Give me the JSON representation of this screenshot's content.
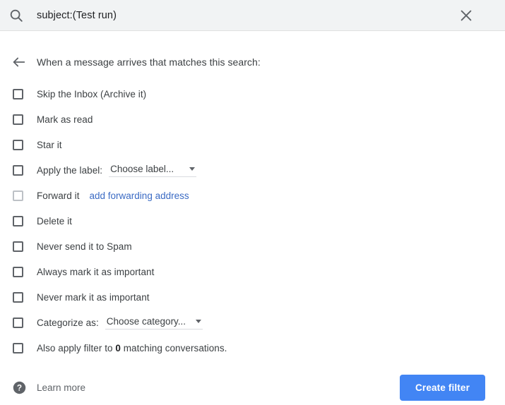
{
  "search": {
    "query": "subject:(Test run)",
    "search_icon": "search-icon",
    "close_icon": "close-icon"
  },
  "heading": {
    "back_icon": "back-arrow-icon",
    "text": "When a message arrives that matches this search:"
  },
  "options": [
    {
      "label": "Skip the Inbox (Archive it)",
      "name": "skip-the-inbox",
      "disabled": false
    },
    {
      "label": "Mark as read",
      "name": "mark-as-read",
      "disabled": false
    },
    {
      "label": "Star it",
      "name": "star-it",
      "disabled": false
    },
    {
      "label": "Apply the label:",
      "name": "apply-the-label",
      "disabled": false,
      "dropdown": {
        "value": "Choose label...",
        "name": "choose-label-dropdown"
      }
    },
    {
      "label": "Forward it",
      "name": "forward-it",
      "disabled": true,
      "link": {
        "text": "add forwarding address",
        "name": "add-forwarding-address-link"
      }
    },
    {
      "label": "Delete it",
      "name": "delete-it",
      "disabled": false
    },
    {
      "label": "Never send it to Spam",
      "name": "never-send-it-to-spam",
      "disabled": false
    },
    {
      "label": "Always mark it as important",
      "name": "always-mark-it-as-important",
      "disabled": false
    },
    {
      "label": "Never mark it as important",
      "name": "never-mark-it-as-important",
      "disabled": false
    },
    {
      "label": "Categorize as:",
      "name": "categorize-as",
      "disabled": false,
      "dropdown": {
        "value": "Choose category...",
        "name": "choose-category-dropdown"
      }
    },
    {
      "label_prefix": "Also apply filter to ",
      "label_bold": "0",
      "label_suffix": " matching conversations.",
      "name": "also-apply-filter",
      "disabled": false
    }
  ],
  "footer": {
    "help_icon": "help-icon",
    "learn_more": "Learn more",
    "create_filter": "Create filter"
  },
  "colors": {
    "accent_blue": "#4285f4",
    "link_blue": "#3b6bc4",
    "searchbar_bg": "#f1f3f4",
    "text": "#3c4043",
    "icon_gray": "#5f6368"
  }
}
